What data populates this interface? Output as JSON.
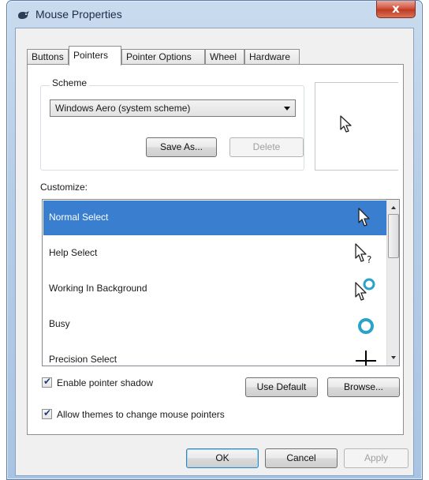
{
  "window": {
    "title": "Mouse Properties",
    "close_glyph": "x",
    "title_icon": "mouse-icon"
  },
  "tabs": [
    {
      "label": "Buttons",
      "active": false
    },
    {
      "label": "Pointers",
      "active": true
    },
    {
      "label": "Pointer Options",
      "active": false
    },
    {
      "label": "Wheel",
      "active": false
    },
    {
      "label": "Hardware",
      "active": false
    }
  ],
  "scheme": {
    "group_label": "Scheme",
    "selected": "Windows Aero (system scheme)",
    "save_as_label": "Save As...",
    "delete_label": "Delete",
    "preview_icon": "arrow-pointer-icon"
  },
  "customize": {
    "label": "Customize:",
    "items": [
      {
        "label": "Normal Select",
        "icon": "arrow-pointer-icon",
        "selected": true
      },
      {
        "label": "Help Select",
        "icon": "help-pointer-icon",
        "selected": false
      },
      {
        "label": "Working In Background",
        "icon": "working-pointer-icon",
        "selected": false
      },
      {
        "label": "Busy",
        "icon": "busy-ring-icon",
        "selected": false
      },
      {
        "label": "Precision Select",
        "icon": "crosshair-icon",
        "selected": false
      }
    ]
  },
  "options": {
    "shadow_label": "Enable pointer shadow",
    "shadow_checked": true,
    "themes_label": "Allow themes to change mouse pointers",
    "themes_checked": true,
    "use_default_label": "Use Default",
    "browse_label": "Browse..."
  },
  "footer": {
    "ok_label": "OK",
    "cancel_label": "Cancel",
    "apply_label": "Apply"
  },
  "colors": {
    "selection": "#3a7fcf",
    "close_button": "#c8452c",
    "busy_ring": "#2aa3c9"
  }
}
